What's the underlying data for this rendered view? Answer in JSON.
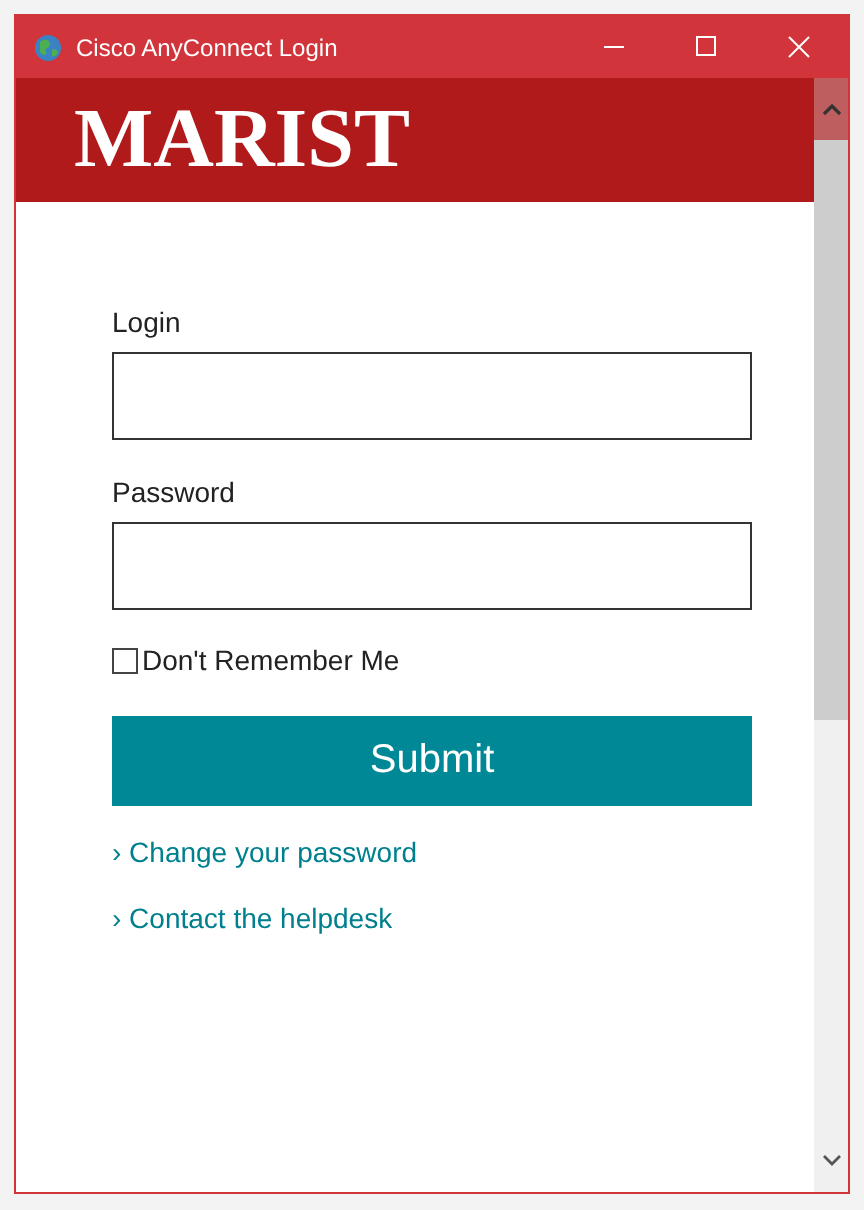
{
  "window": {
    "title": "Cisco AnyConnect Login"
  },
  "header": {
    "logo": "MARIST"
  },
  "fields": [
    {
      "label": "Login"
    },
    {
      "label": "Password"
    }
  ],
  "checkbox": {
    "label": "Don't Remember Me",
    "checked": false
  },
  "submit": {
    "label": "Submit"
  },
  "links": [
    "› Change your password",
    "› Contact the helpdesk"
  ]
}
